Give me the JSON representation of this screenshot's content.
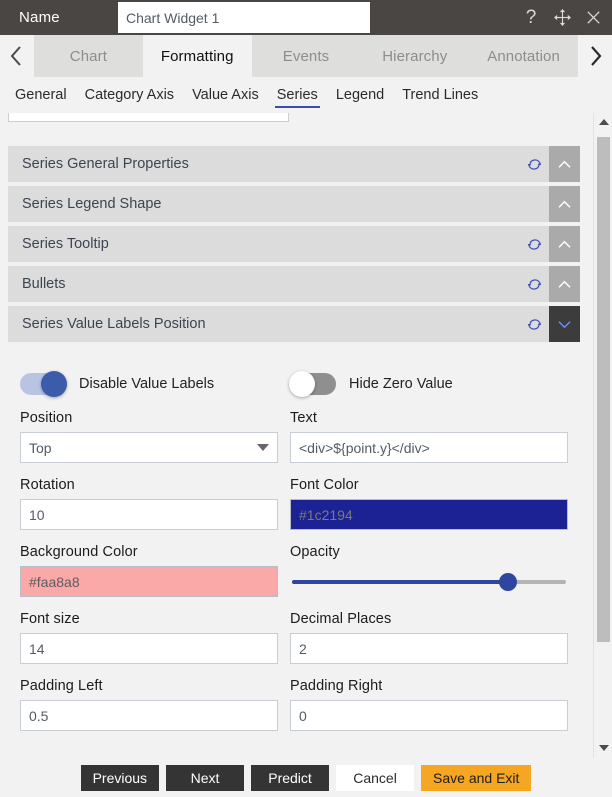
{
  "titlebar": {
    "name_label": "Name",
    "widget_name_value": "Chart Widget 1",
    "icons": {
      "help": "help-icon",
      "move": "move-icon",
      "close": "close-icon"
    }
  },
  "main_tabs": {
    "prev_arrow": "chevron-left-icon",
    "next_arrow": "chevron-right-icon",
    "items": [
      {
        "label": "Chart",
        "active": false
      },
      {
        "label": "Formatting",
        "active": true
      },
      {
        "label": "Events",
        "active": false
      },
      {
        "label": "Hierarchy",
        "active": false
      },
      {
        "label": "Annotation",
        "active": false
      }
    ]
  },
  "sub_tabs": {
    "items": [
      {
        "label": "General",
        "active": false
      },
      {
        "label": "Category Axis",
        "active": false
      },
      {
        "label": "Value Axis",
        "active": false
      },
      {
        "label": "Series",
        "active": true
      },
      {
        "label": "Legend",
        "active": false
      },
      {
        "label": "Trend Lines",
        "active": false
      }
    ]
  },
  "accordions": [
    {
      "title": "Series General Properties",
      "has_refresh": true,
      "open": false,
      "chevron": "chevron-up-icon"
    },
    {
      "title": "Series Legend Shape",
      "has_refresh": false,
      "open": false,
      "chevron": "chevron-up-icon"
    },
    {
      "title": "Series Tooltip",
      "has_refresh": true,
      "open": false,
      "chevron": "chevron-up-icon"
    },
    {
      "title": "Bullets",
      "has_refresh": true,
      "open": false,
      "chevron": "chevron-up-icon"
    },
    {
      "title": "Series Value Labels Position",
      "has_refresh": true,
      "open": true,
      "chevron": "chevron-down-icon"
    }
  ],
  "form": {
    "toggles": [
      {
        "label": "Disable Value Labels",
        "state": "on"
      },
      {
        "label": "Hide Zero Value",
        "state": "off"
      }
    ],
    "position": {
      "label": "Position",
      "value": "Top"
    },
    "text": {
      "label": "Text",
      "value": "<div>${point.y}</div>"
    },
    "rotation": {
      "label": "Rotation",
      "value": "10"
    },
    "font_color": {
      "label": "Font Color",
      "value": "#1c2194",
      "swatch": "#1c2194"
    },
    "background_color": {
      "label": "Background Color",
      "value": "#faa8a8",
      "swatch": "#faa8a8"
    },
    "opacity": {
      "label": "Opacity",
      "percent": 79,
      "fill_color": "#2f46a0"
    },
    "font_size": {
      "label": "Font size",
      "value": "14"
    },
    "decimal_places": {
      "label": "Decimal Places",
      "value": "2"
    },
    "padding_left": {
      "label": "Padding Left",
      "value": "0.5"
    },
    "padding_right": {
      "label": "Padding Right",
      "value": "0"
    }
  },
  "scrollbar": {
    "up_arrow": "scroll-up-icon",
    "down_arrow": "scroll-down-icon"
  },
  "footer": {
    "previous": "Previous",
    "next": "Next",
    "predict": "Predict",
    "cancel": "Cancel",
    "save_and_exit": "Save and Exit",
    "accent_color": "#f5a623"
  }
}
